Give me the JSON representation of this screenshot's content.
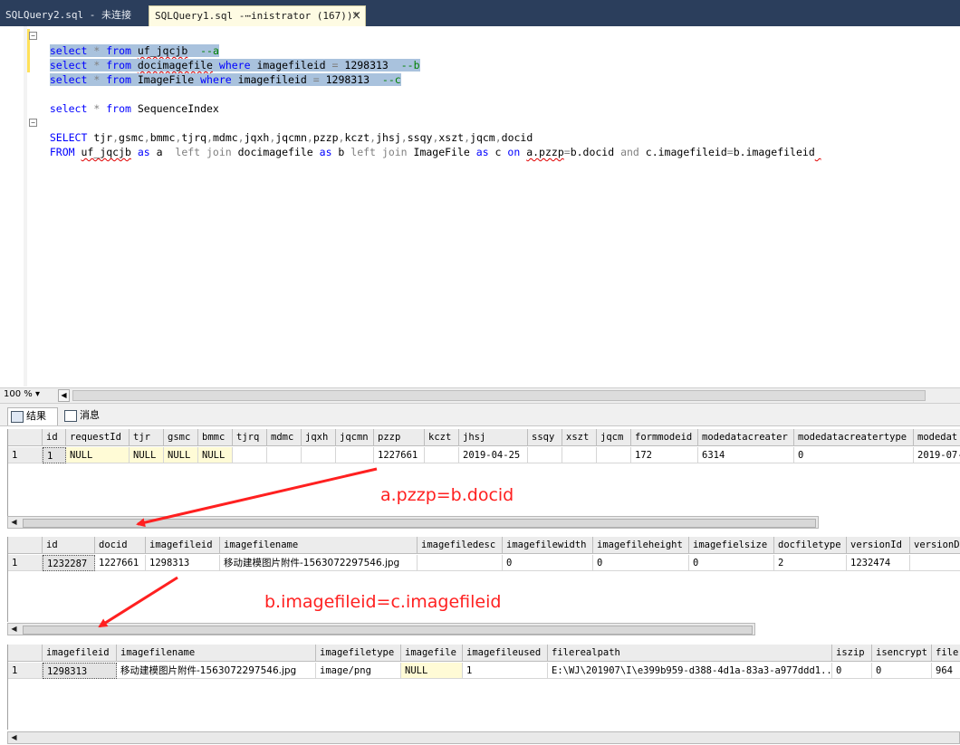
{
  "tabs": [
    {
      "label": "SQLQuery2.sql - 未连接"
    },
    {
      "label": "SQLQuery1.sql -⋯inistrator (167))*",
      "close": "×"
    }
  ],
  "editor": {
    "lines": [
      "select * from uf_jqcjb  --a",
      "select * from docimagefile where imagefileid = 1298313  --b",
      "select * from ImageFile where imagefileid = 1298313  --c",
      "select * from SequenceIndex",
      "SELECT tjr,gsmc,bmmc,tjrq,mdmc,jqxh,jqcmn,pzzp,kczt,jhsj,ssqy,xszt,jqcm,docid",
      "FROM uf_jqcjb as a  left join docimagefile as b left join ImageFile as c on a.pzzp=b.docid and c.imagefileid=b.imagefileid"
    ]
  },
  "zoom": "100 %",
  "result_tabs": [
    {
      "label": "结果"
    },
    {
      "label": "消息"
    }
  ],
  "grid1": {
    "headers": [
      "id",
      "requestId",
      "tjr",
      "gsmc",
      "bmmc",
      "tjrq",
      "mdmc",
      "jqxh",
      "jqcmn",
      "pzzp",
      "kczt",
      "jhsj",
      "ssqy",
      "xszt",
      "jqcm",
      "formmodeid",
      "modedatacreater",
      "modedatacreatertype",
      "modedat"
    ],
    "rows": [
      [
        "1",
        "1",
        "NULL",
        "NULL",
        "NULL",
        "NULL",
        "",
        "",
        "",
        "",
        "1227661",
        "",
        "2019-04-25",
        "",
        "",
        "",
        "172",
        "6314",
        "0",
        "2019-07-"
      ]
    ]
  },
  "grid2": {
    "headers": [
      "id",
      "docid",
      "imagefileid",
      "imagefilename",
      "imagefiledesc",
      "imagefilewidth",
      "imagefileheight",
      "imagefielsize",
      "docfiletype",
      "versionId",
      "versionDe"
    ],
    "rows": [
      [
        "1",
        "1232287",
        "1227661",
        "1298313",
        "移动建模图片附件-1563072297546.jpg",
        "",
        "0",
        "0",
        "0",
        "2",
        "1232474",
        ""
      ]
    ]
  },
  "grid3": {
    "headers": [
      "imagefileid",
      "imagefilename",
      "imagefiletype",
      "imagefile",
      "imagefileused",
      "filerealpath",
      "iszip",
      "isencrypt",
      "file"
    ],
    "rows": [
      [
        "1",
        "1298313",
        "移动建模图片附件-1563072297546.jpg",
        "image/png",
        "NULL",
        "1",
        "E:\\WJ\\201907\\I\\e399b959-d388-4d1a-83a3-a977ddd1...",
        "0",
        "0",
        "964"
      ]
    ]
  },
  "annotations": [
    "a.pzzp=b.docid",
    "b.imagefileid=c.imagefileid"
  ],
  "colors": {
    "annotation": "#ff2020",
    "keyword": "#0000ff",
    "comment": "#008000",
    "selection": "#a9c2dd",
    "tabbar": "#2b3e5c"
  }
}
